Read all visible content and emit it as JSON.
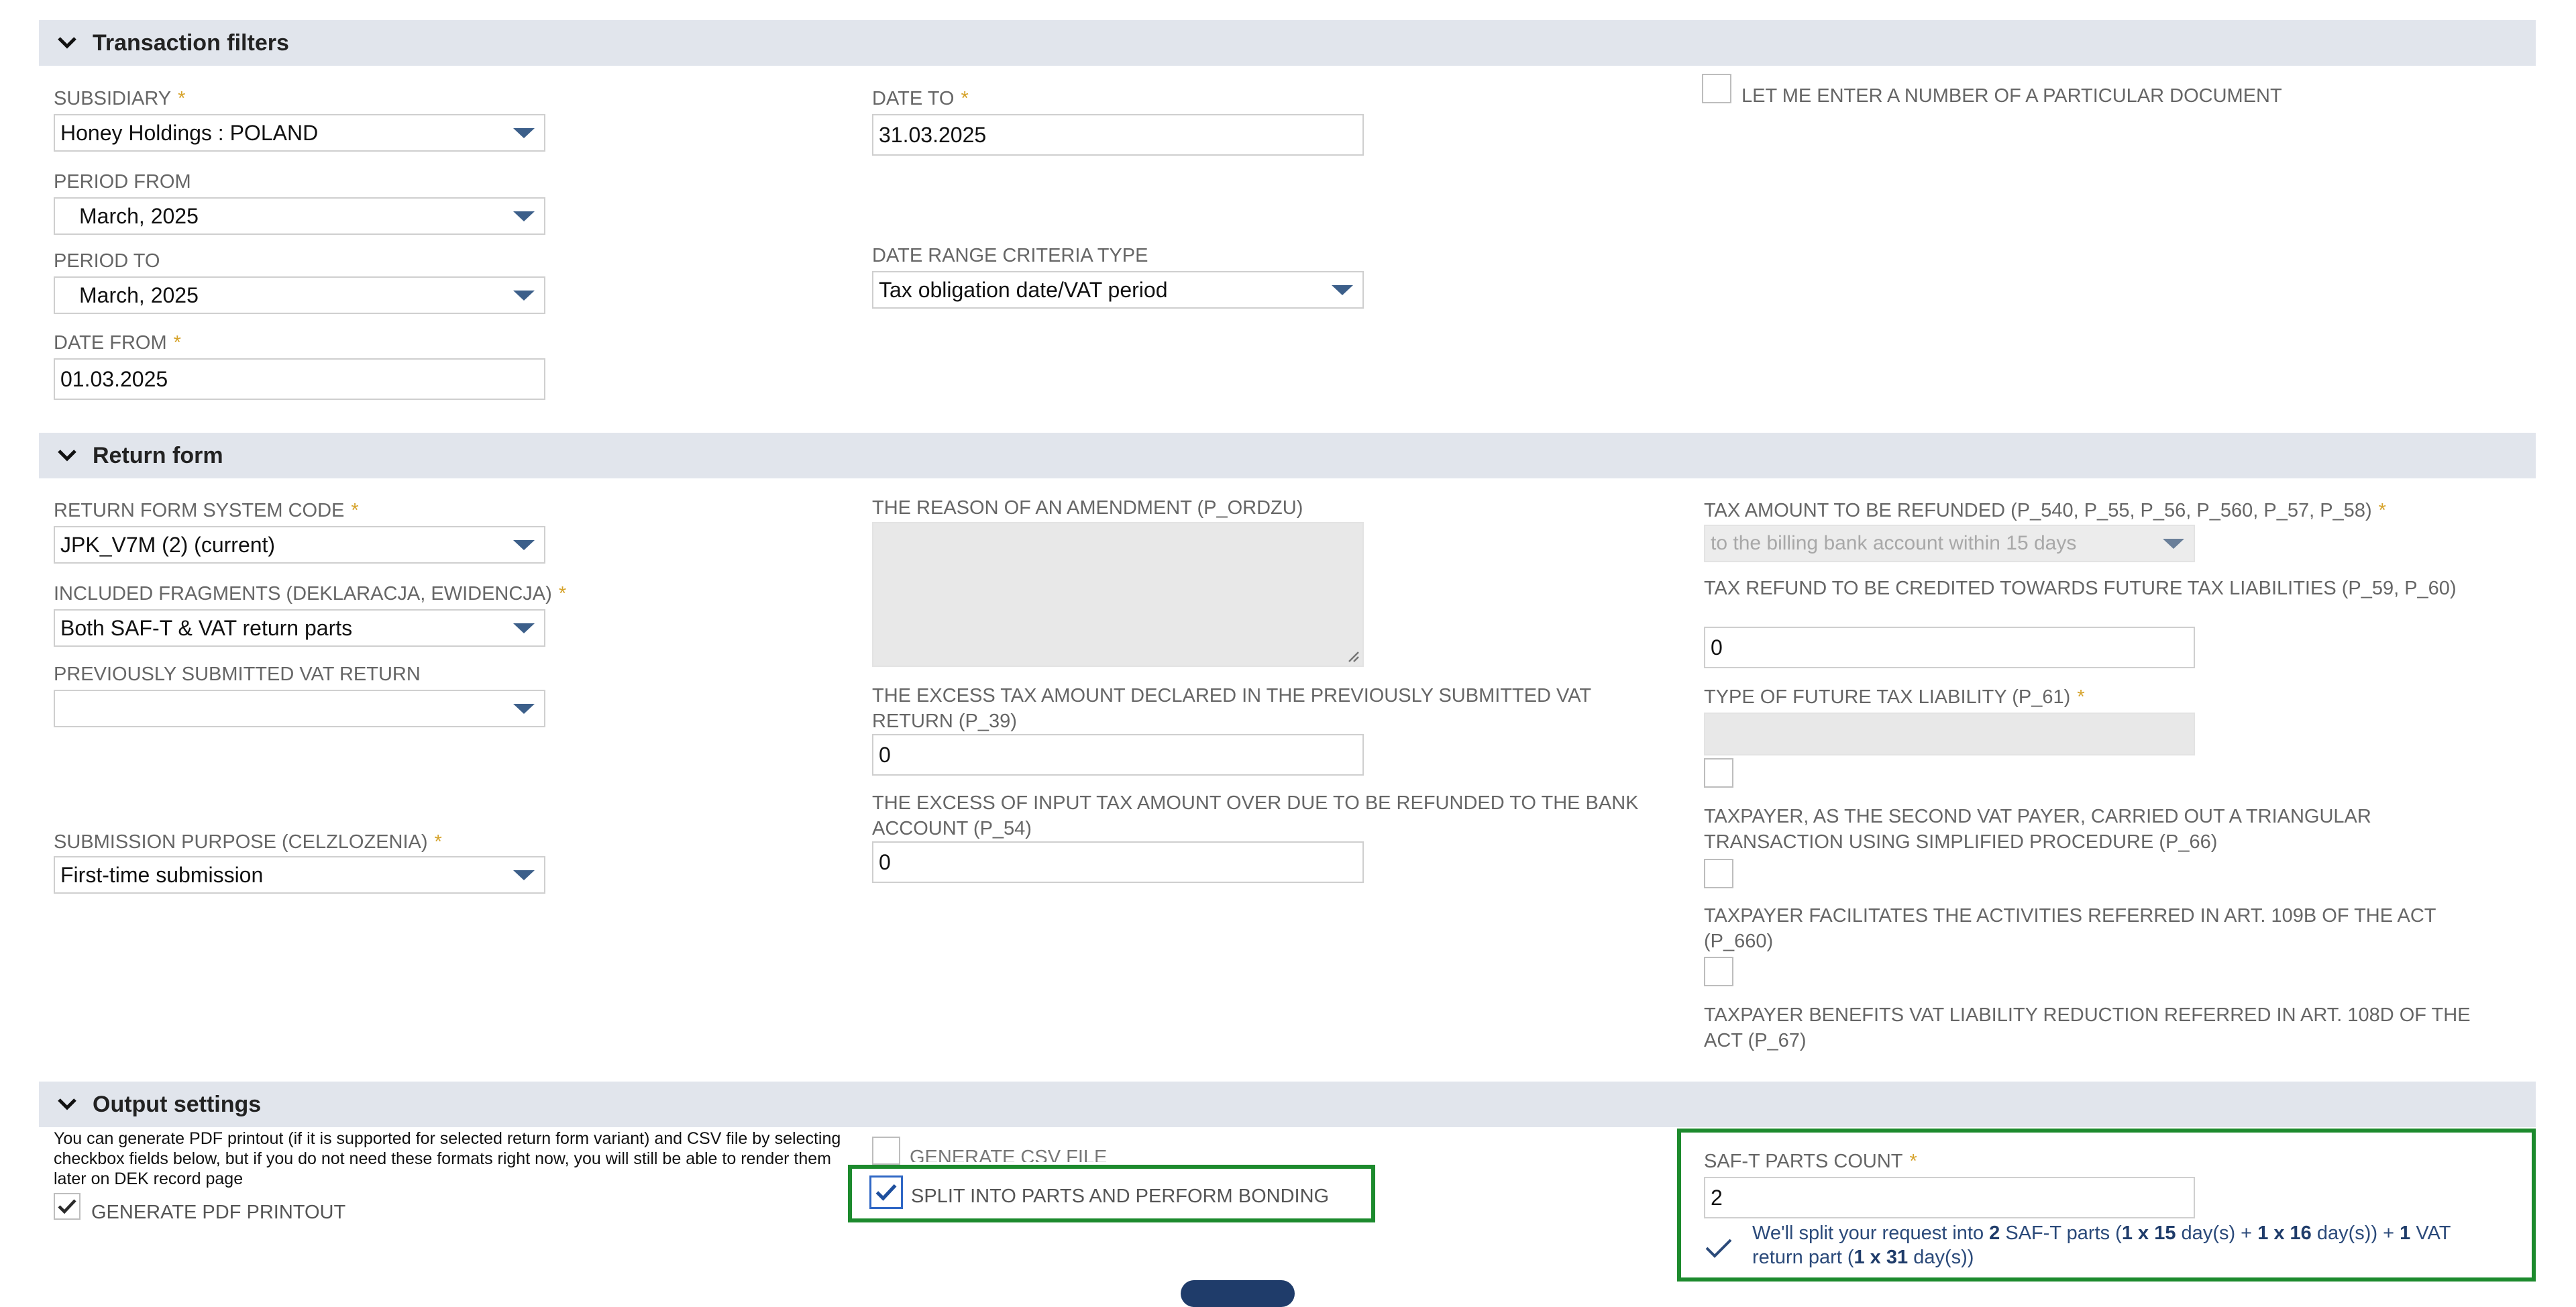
{
  "sections": {
    "transaction_filters": "Transaction filters",
    "return_form": "Return form",
    "output_settings": "Output settings"
  },
  "transaction_filters": {
    "subsidiary_label": "SUBSIDIARY",
    "subsidiary_value": "Honey Holdings : POLAND",
    "period_from_label": "PERIOD FROM",
    "period_from_value": "March, 2025",
    "period_to_label": "PERIOD TO",
    "period_to_value": "March, 2025",
    "date_from_label": "DATE FROM",
    "date_from_value": "01.03.2025",
    "date_to_label": "DATE TO",
    "date_to_value": "31.03.2025",
    "date_range_label": "DATE RANGE CRITERIA TYPE",
    "date_range_value": "Tax obligation date/VAT period",
    "particular_doc_label": "LET ME ENTER A NUMBER OF A PARTICULAR DOCUMENT",
    "required_mark": "*"
  },
  "return_form": {
    "system_code_label": "RETURN FORM SYSTEM CODE",
    "system_code_value": "JPK_V7M (2)  (current)",
    "fragments_label": "INCLUDED FRAGMENTS (DEKLARACJA, EWIDENCJA)",
    "fragments_value": "Both SAF-T & VAT return parts",
    "prev_return_label": "PREVIOUSLY SUBMITTED VAT RETURN",
    "prev_return_value": "",
    "purpose_label": "SUBMISSION PURPOSE (CELZLOZENIA)",
    "purpose_value": "First-time submission",
    "amendment_label": "THE REASON OF AN AMENDMENT (P_ORDZU)",
    "amendment_value": "",
    "excess_prev_label": "THE EXCESS TAX AMOUNT DECLARED IN THE PREVIOUSLY SUBMITTED VAT RETURN (P_39)",
    "excess_prev_value": "0",
    "excess_input_label": "THE EXCESS OF INPUT TAX AMOUNT OVER DUE TO BE REFUNDED TO THE BANK ACCOUNT (P_54)",
    "excess_input_value": "0",
    "refund_label": "TAX AMOUNT TO BE REFUNDED (P_540, P_55, P_56, P_560, P_57, P_58)",
    "refund_value": "to the billing bank account within 15 days",
    "credited_label": "TAX REFUND TO BE CREDITED TOWARDS FUTURE TAX LIABILITIES (P_59, P_60)",
    "credited_value": "0",
    "future_type_label": "TYPE OF FUTURE TAX LIABILITY (P_61)",
    "triangular_label": "TAXPAYER, AS THE SECOND VAT PAYER, CARRIED OUT A TRIANGULAR TRANSACTION USING SIMPLIFIED PROCEDURE (P_66)",
    "art109b_label": "TAXPAYER FACILITATES THE ACTIVITIES REFERRED IN ART. 109B OF THE ACT (P_660)",
    "art108d_label": "TAXPAYER BENEFITS VAT LIABILITY REDUCTION REFERRED IN ART. 108D OF THE ACT (P_67)"
  },
  "output_settings": {
    "note": "You can generate PDF printout (if it is supported for selected return form variant) and CSV file by selecting checkbox fields below, but if you do not need these formats right now, you will still be able to render them later on DEK record page",
    "pdf_label": "GENERATE PDF PRINTOUT",
    "csv_label": "GENERATE CSV FILE",
    "split_label": "SPLIT INTO PARTS AND PERFORM BONDING",
    "parts_count_label": "SAF-T PARTS COUNT",
    "parts_count_value": "2",
    "split_info": {
      "t1": "We'll split your request into ",
      "n1": "2",
      "t2": " SAF-T parts (",
      "n2": "1 x 15",
      "t3": " day(s) + ",
      "n3": "1 x 16",
      "t4": " day(s)) + ",
      "n4": "1",
      "t5": " VAT",
      "t6": "return part (",
      "n5": "1 x 31",
      "t7": " day(s))"
    }
  },
  "icons": {
    "section_toggle": "chevron-down-icon",
    "checked": "checkmark-icon",
    "dropdown": "caret-down-icon"
  },
  "colors": {
    "section_bg": "#e1e5ec",
    "required": "#d6a32b",
    "highlight": "#1c8a2d",
    "dropdown_arrow": "#3c5f8a",
    "info_text": "#2b4a7a"
  }
}
